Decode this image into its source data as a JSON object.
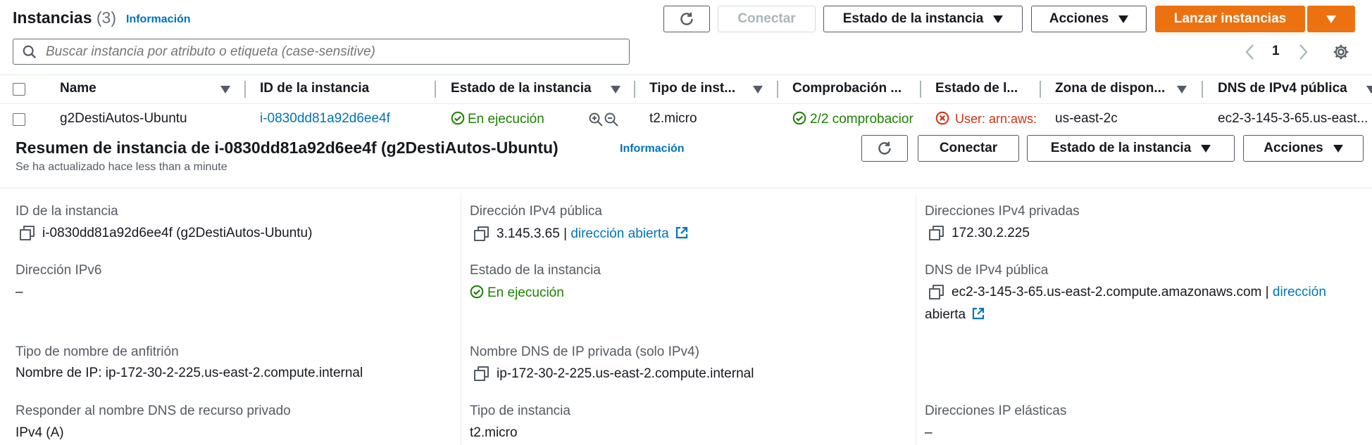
{
  "header": {
    "title": "Instancias",
    "count": "(3)",
    "info": "Información",
    "buttons": {
      "connect": "Conectar",
      "instance_state": "Estado de la instancia",
      "actions": "Acciones",
      "launch": "Lanzar instancias"
    }
  },
  "search": {
    "placeholder": "Buscar instancia por atributo o etiqueta (case-sensitive)"
  },
  "pagination": {
    "page": "1"
  },
  "table": {
    "columns": [
      "Name",
      "ID de la instancia",
      "Estado de la instancia",
      "Tipo de inst...",
      "Comprobación ...",
      "Estado de l...",
      "Zona de dispon...",
      "DNS de IPv4 pública"
    ],
    "row": {
      "name": "g2DestiAutos-Ubuntu",
      "id": "i-0830dd81a92d6ee4f",
      "state": "En ejecución",
      "type": "t2.micro",
      "checks": "2/2 comprobacior",
      "alarm": "User: arn:aws:",
      "zone": "us-east-2c",
      "dns": "ec2-3-145-3-65.us-east..."
    }
  },
  "summary": {
    "title": "Resumen de instancia de i-0830dd81a92d6ee4f (g2DestiAutos-Ubuntu)",
    "info": "Información",
    "updated": "Se ha actualizado hace less than a minute",
    "buttons": {
      "connect": "Conectar",
      "instance_state": "Estado de la instancia",
      "actions": "Acciones"
    }
  },
  "details": {
    "col1": {
      "instance_id_label": "ID de la instancia",
      "instance_id_value": "i-0830dd81a92d6ee4f (g2DestiAutos-Ubuntu)",
      "ipv6_label": "Dirección IPv6",
      "ipv6_value": "–",
      "hostname_type_label": "Tipo de nombre de anfitrión",
      "hostname_type_value": "Nombre de IP: ip-172-30-2-225.us-east-2.compute.internal",
      "resource_dns_label": "Responder al nombre DNS de recurso privado",
      "resource_dns_value": "IPv4 (A)"
    },
    "col2": {
      "public_ipv4_label": "Dirección IPv4 pública",
      "public_ipv4_value": "3.145.3.65 |",
      "public_ipv4_link": "dirección abierta",
      "state_label": "Estado de la instancia",
      "state_value": "En ejecución",
      "private_dns_label": "Nombre DNS de IP privada (solo IPv4)",
      "private_dns_value": "ip-172-30-2-225.us-east-2.compute.internal",
      "type_label": "Tipo de instancia",
      "type_value": "t2.micro"
    },
    "col3": {
      "private_ipv4_label": "Direcciones IPv4 privadas",
      "private_ipv4_value": "172.30.2.225",
      "public_dns_label": "DNS de IPv4 pública",
      "public_dns_value": "ec2-3-145-3-65.us-east-2.compute.amazonaws.com |",
      "public_dns_link_1": "dirección",
      "public_dns_link_2": "abierta",
      "elastic_ip_label": "Direcciones IP elásticas",
      "elastic_ip_value": "–"
    }
  }
}
